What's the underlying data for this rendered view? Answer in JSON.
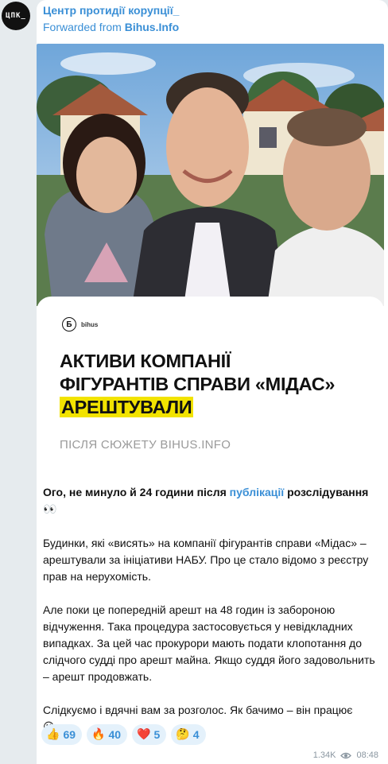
{
  "channel": {
    "avatar_text": "ЦПК_",
    "name": "Центр протидії корупції_",
    "forwarded_prefix": "Forwarded from ",
    "forwarded_source": "Bihus.Info"
  },
  "card": {
    "brand": "bihus",
    "brand_letter": "Б",
    "headline_line1": "АКТИВИ КОМПАНІЇ",
    "headline_line2": "ФІГУРАНТІВ СПРАВИ «МІДАС»",
    "headline_line3": "АРЕШТУВАЛИ",
    "subtitle": "ПІСЛЯ СЮЖЕТУ BIHUS.INFO"
  },
  "message": {
    "p1_a": "Ого, не минуло й 24 години після ",
    "p1_link": "публікації",
    "p1_b": " розслідування ",
    "p1_emoji": "👀",
    "p2": "Будинки, які «висять» на компанії фігурантів справи «Мідас» – арештували за ініціативи НАБУ. Про це стало відомо з реєстру прав на нерухомість.",
    "p3": "Але поки це попередній арешт на 48 годин із забороною відчуження. Така процедура застосовується у невідкладних випадках. За цей час прокурори мають подати клопотання до слідчого судді про арешт майна. Якщо суддя його задовольнить – арешт продовжать.",
    "p4": "Слідкуємо і вдячні вам за розголос. Як бачимо – він працює",
    "p4_emoji": "😉"
  },
  "reactions": [
    {
      "emoji": "👍",
      "count": "69"
    },
    {
      "emoji": "🔥",
      "count": "40"
    },
    {
      "emoji": "❤️",
      "count": "5"
    },
    {
      "emoji": "🤔",
      "count": "4"
    }
  ],
  "meta": {
    "views": "1.34K",
    "time": "08:48"
  },
  "colors": {
    "accent": "#3a8fd6",
    "highlight": "#f2e300",
    "background": "#e6ebee"
  }
}
